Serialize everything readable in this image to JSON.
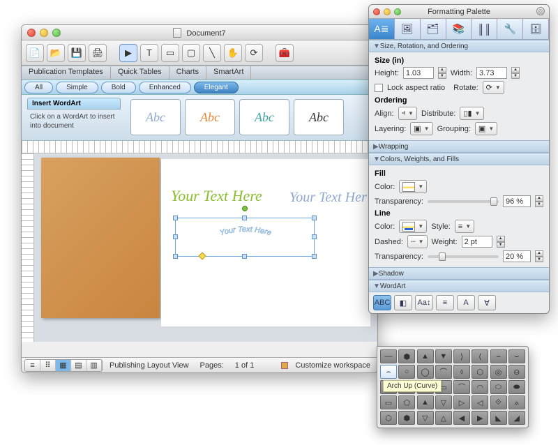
{
  "main": {
    "title": "Document7",
    "tabs": [
      "Publication Templates",
      "Quick Tables",
      "Charts",
      "SmartArt"
    ],
    "filters": [
      "All",
      "Simple",
      "Bold",
      "Enhanced",
      "Elegant"
    ],
    "filter_selected": "Elegant",
    "wordart_panel": {
      "title": "Insert WordArt",
      "desc": "Click on a WordArt to insert into document"
    },
    "swatch_text": "Abc",
    "canvas": {
      "text1": "Your Text Here",
      "text2": "Your Text Her",
      "text3_arc": "Your Text Here"
    },
    "status": {
      "view_label": "Publishing Layout View",
      "pages_label": "Pages:",
      "pages_value": "1 of 1",
      "customize": "Customize workspace"
    }
  },
  "palette": {
    "title": "Formatting Palette",
    "sections": {
      "size": {
        "header": "Size, Rotation, and Ordering",
        "size_label": "Size (in)",
        "height_label": "Height:",
        "height_value": "1.03",
        "width_label": "Width:",
        "width_value": "3.73",
        "lock_label": "Lock aspect ratio",
        "rotate_label": "Rotate:",
        "ordering_label": "Ordering",
        "align_label": "Align:",
        "distribute_label": "Distribute:",
        "layering_label": "Layering:",
        "grouping_label": "Grouping:"
      },
      "wrapping": {
        "header": "Wrapping"
      },
      "colors": {
        "header": "Colors, Weights, and Fills",
        "fill_label": "Fill",
        "color_label": "Color:",
        "transparency_label": "Transparency:",
        "fill_transparency": "96 %",
        "line_label": "Line",
        "style_label": "Style:",
        "dashed_label": "Dashed:",
        "weight_label": "Weight:",
        "weight_value": "2 pt",
        "line_transparency": "20 %"
      },
      "shadow": {
        "header": "Shadow"
      },
      "wordart": {
        "header": "WordArt",
        "tool_labels": [
          "ABC",
          "◧",
          "Aa↕",
          "≡",
          "A",
          "∀"
        ]
      }
    }
  },
  "tooltip": "Arch Up (Curve)"
}
